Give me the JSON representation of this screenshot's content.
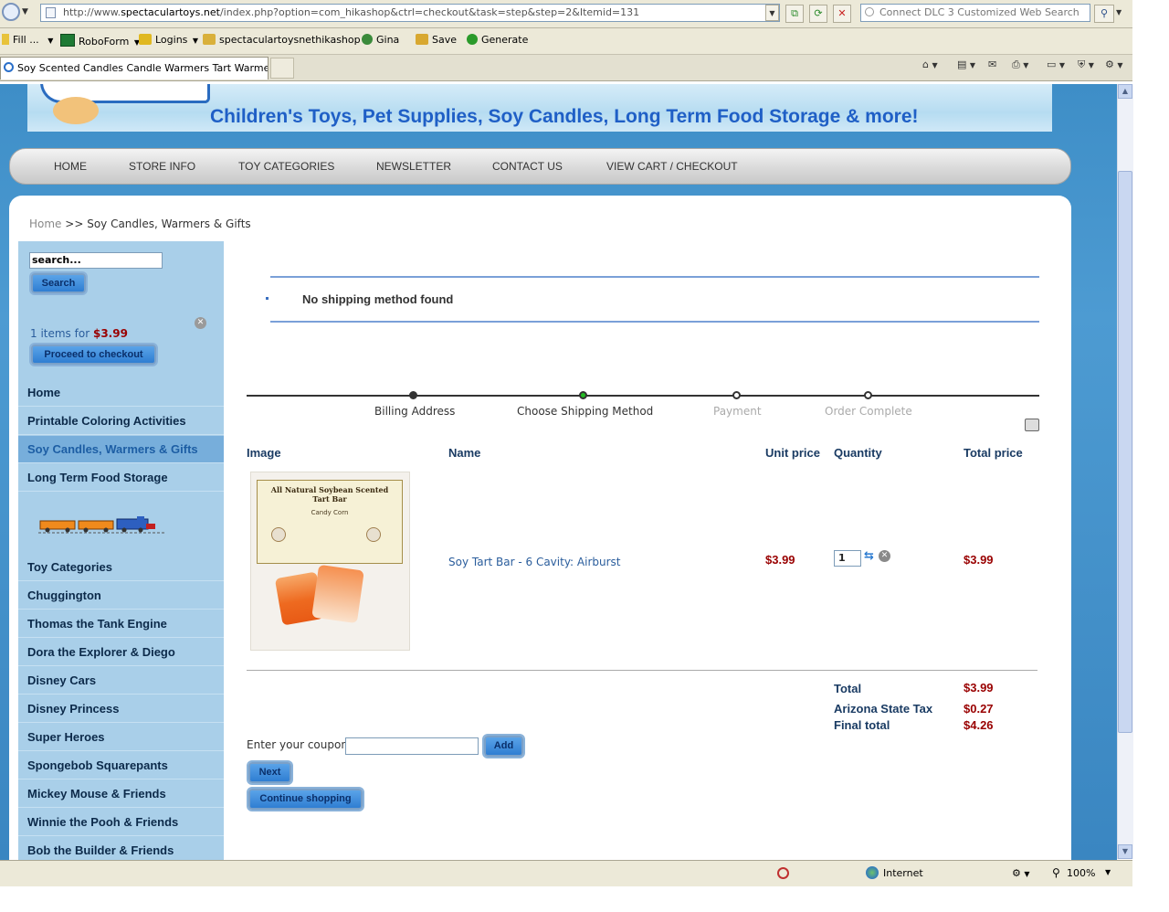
{
  "browser": {
    "url_prefix": "http://www.",
    "url_domain": "spectaculartoys.net",
    "url_path": "/index.php?option=com_hikashop&ctrl=checkout&task=step&step=2&Itemid=131",
    "search_placeholder": "Connect DLC 3 Customized Web Search",
    "toolbar": {
      "fill": "Fill ...",
      "roboform": "RoboForm",
      "logins": "Logins",
      "site": "spectaculartoysnethikashop",
      "gina": "Gina",
      "save": "Save",
      "generate": "Generate"
    },
    "tab_title": "Soy Scented Candles Candle Warmers Tart Warmers ...",
    "status_zone": "Internet",
    "zoom": "100%"
  },
  "site": {
    "banner_text": "Children's Toys, Pet Supplies, Soy Candles, Long Term Food Storage & more!",
    "nav": [
      "HOME",
      "STORE INFO",
      "TOY CATEGORIES",
      "NEWSLETTER",
      "CONTACT US",
      "VIEW CART / CHECKOUT"
    ],
    "breadcrumb": {
      "home": "Home",
      "separator": ">>",
      "current": "Soy Candles, Warmers & Gifts"
    }
  },
  "sidebar": {
    "search_value": "search...",
    "search_button": "Search",
    "cart_text": "1 items for",
    "cart_price": "$3.99",
    "checkout_button": "Proceed to checkout",
    "menu_top": [
      "Home",
      "Printable Coloring Activities",
      "Soy Candles, Warmers & Gifts",
      "Long Term Food Storage"
    ],
    "menu_bottom": [
      "Toy Categories",
      "Chuggington",
      "Thomas the Tank Engine",
      "Dora the Explorer & Diego",
      "Disney Cars",
      "Disney Princess",
      "Super Heroes",
      "Spongebob Squarepants",
      "Mickey Mouse & Friends",
      "Winnie the Pooh & Friends",
      "Bob the Builder & Friends"
    ]
  },
  "checkout": {
    "message": "No shipping method found",
    "steps": [
      "Billing Address",
      "Choose Shipping Method",
      "Payment",
      "Order Complete"
    ],
    "columns": {
      "image": "Image",
      "name": "Name",
      "unit_price": "Unit price",
      "quantity": "Quantity",
      "total_price": "Total price"
    },
    "item": {
      "name": "Soy Tart Bar - 6 Cavity: Airburst",
      "unit_price": "$3.99",
      "quantity": "1",
      "total_price": "$3.99",
      "image_title": "All Natural Soybean Scented Tart Bar",
      "image_sub": "Candy Corn"
    },
    "totals": {
      "total_label": "Total",
      "total": "$3.99",
      "tax_label": "Arizona State Tax",
      "tax": "$0.27",
      "final_label": "Final total",
      "final": "$4.26"
    },
    "coupon_label": "Enter your coupon",
    "add_button": "Add",
    "next_button": "Next",
    "continue_button": "Continue shopping"
  },
  "colors": {
    "accent_red": "#990000",
    "link_blue": "#2a5d9c",
    "active_step": "#22bb22",
    "banner_blue": "#1f5fc6"
  }
}
